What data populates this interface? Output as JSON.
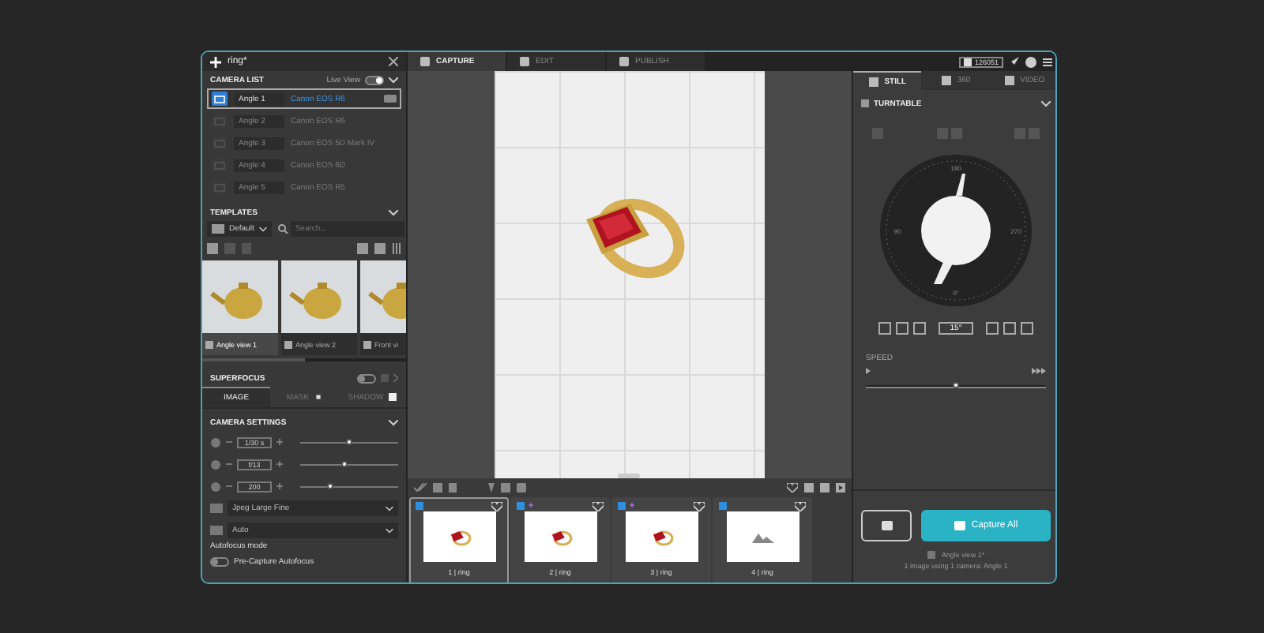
{
  "window": {
    "title": "ring*"
  },
  "camera_list": {
    "title": "CAMERA LIST",
    "live_view_label": "Live View",
    "live_view_on": true,
    "cameras": [
      {
        "angle": "Angle 1",
        "model": "Canon EOS R6",
        "selected": true
      },
      {
        "angle": "Angle 2",
        "model": "Canon EOS R6",
        "selected": false
      },
      {
        "angle": "Angle 3",
        "model": "Canon EOS 5D Mark IV",
        "selected": false
      },
      {
        "angle": "Angle 4",
        "model": "Canon EOS 6D",
        "selected": false
      },
      {
        "angle": "Angle 5",
        "model": "Canon EOS R5",
        "selected": false
      }
    ]
  },
  "templates": {
    "title": "TEMPLATES",
    "preset": "Default",
    "search_placeholder": "Search...",
    "items": [
      {
        "label": "Angle view 1",
        "selected": true
      },
      {
        "label": "Angle view 2",
        "selected": false
      },
      {
        "label": "Front vi",
        "selected": false
      }
    ]
  },
  "superfocus": {
    "title": "SUPERFOCUS",
    "on": false
  },
  "mode_tabs": [
    {
      "label": "IMAGE",
      "selected": true,
      "kind": "plain"
    },
    {
      "label": "MASK",
      "selected": false,
      "kind": "check",
      "checked": true
    },
    {
      "label": "SHADOW",
      "selected": false,
      "kind": "check",
      "checked": false
    }
  ],
  "camera_settings": {
    "title": "CAMERA SETTINGS",
    "sliders": [
      {
        "value": "1/30 s",
        "level": 0.5
      },
      {
        "value": "f/13",
        "level": 0.45
      },
      {
        "value": "200",
        "level": 0.3
      }
    ],
    "selects": [
      "Jpeg Large Fine",
      "Auto"
    ],
    "autofocus_label": "Autofocus mode",
    "autofocus_toggle": {
      "label": "Pre-Capture Autofocus",
      "on": false
    }
  },
  "main_tabs": [
    {
      "label": "CAPTURE",
      "selected": true
    },
    {
      "label": "EDIT",
      "selected": false
    },
    {
      "label": "PUBLISH",
      "selected": false
    }
  ],
  "credits": "126051",
  "filmstrip": [
    {
      "label": "1 | ring",
      "selected": true,
      "kind": "image",
      "sparkle": false
    },
    {
      "label": "2 | ring",
      "selected": false,
      "kind": "image",
      "sparkle": true
    },
    {
      "label": "3 | ring",
      "selected": false,
      "kind": "image",
      "sparkle": true
    },
    {
      "label": "4 | ring",
      "selected": false,
      "kind": "placeholder",
      "sparkle": false
    }
  ],
  "right_tabs": [
    {
      "label": "STILL",
      "selected": true
    },
    {
      "label": "360",
      "selected": false
    },
    {
      "label": "VIDEO",
      "selected": false
    }
  ],
  "turntable": {
    "title": "TURNTABLE",
    "enabled": true,
    "angle": "15°",
    "dial_labels": [
      "180",
      "90",
      "270",
      "0°"
    ]
  },
  "speed": {
    "title": "SPEED",
    "level": 0.5
  },
  "capture_button": "Capture All",
  "view_label": "Angle view 1*",
  "summary": "1 image using 1 camera: Angle 1"
}
